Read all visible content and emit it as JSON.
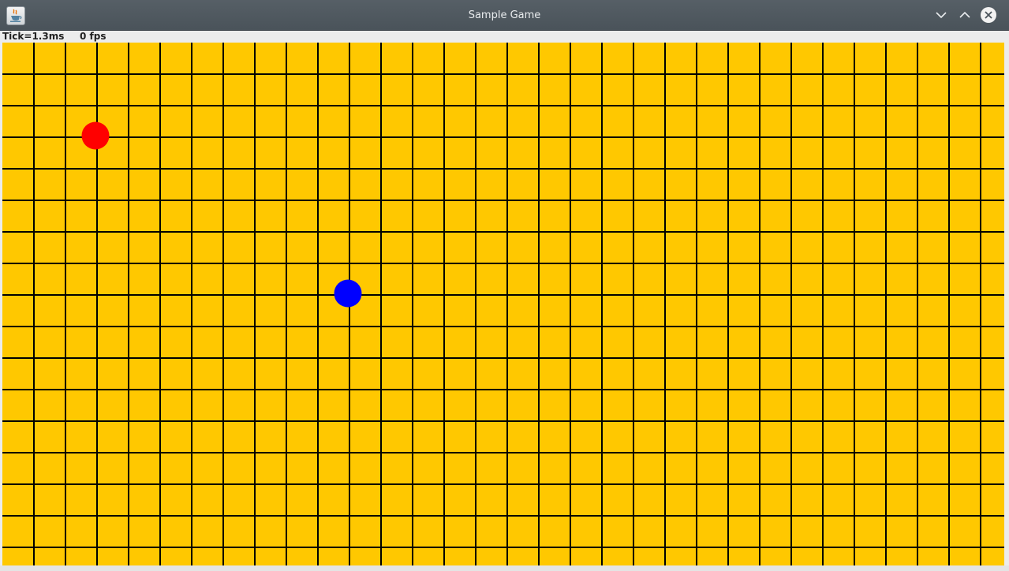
{
  "window": {
    "title": "Sample Game",
    "app_icon": "java-coffee-icon",
    "controls": [
      "minimize-chevron-down-icon",
      "maximize-chevron-up-icon",
      "close-x-icon"
    ]
  },
  "status": {
    "tick": "Tick=1.3ms",
    "fps": "0 fps"
  },
  "game": {
    "board_color": "#FFC800",
    "grid_line_color": "#000000",
    "columns": 32,
    "rows": 17,
    "pieces": [
      {
        "name": "red-ball",
        "color": "#FF0000",
        "col": 3,
        "row": 3
      },
      {
        "name": "blue-ball",
        "color": "#0000FF",
        "col": 11,
        "row": 8
      }
    ]
  }
}
